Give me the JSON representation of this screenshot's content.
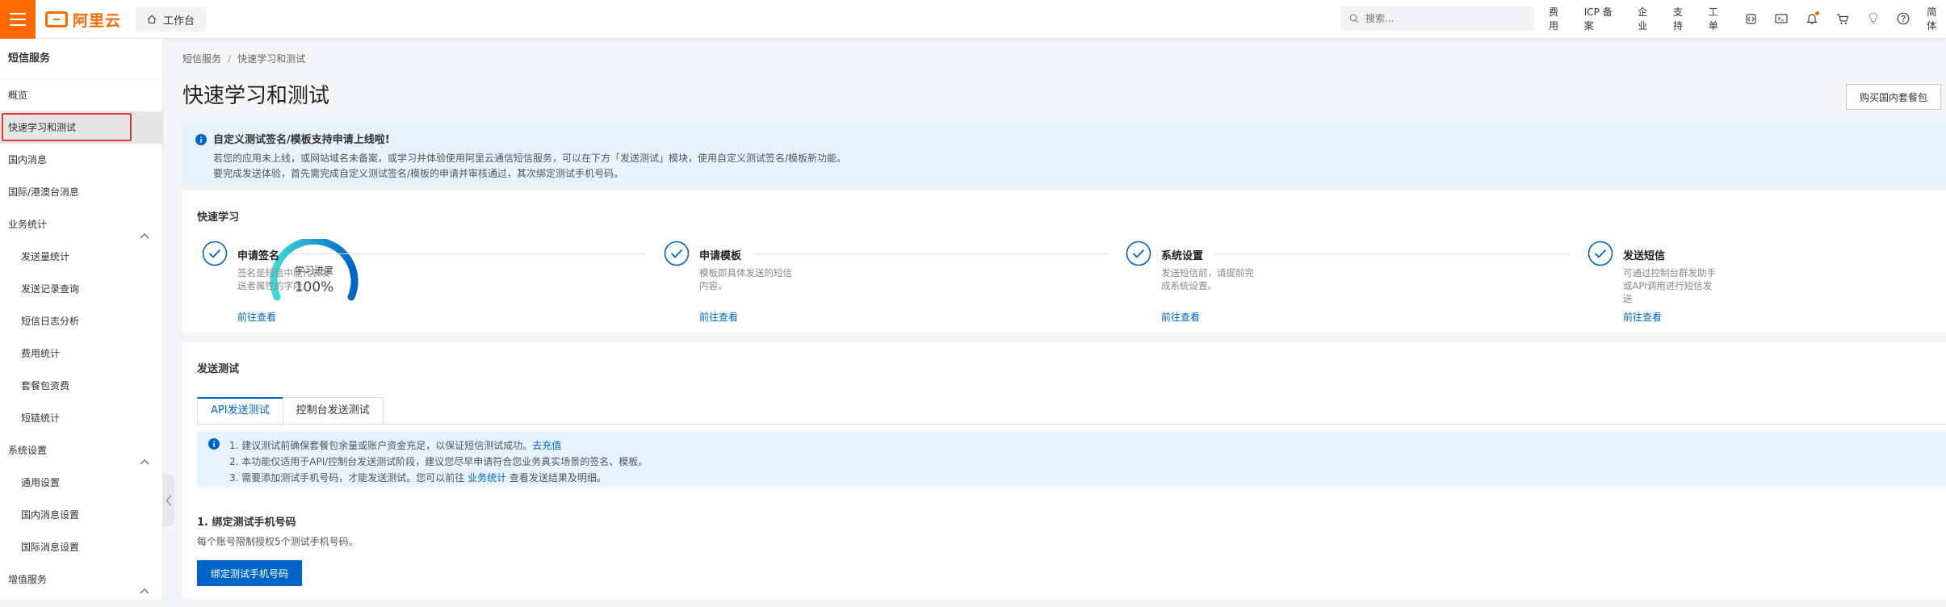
{
  "header": {
    "logo_text": "阿里云",
    "workbench_label": "工作台",
    "search_placeholder": "搜索...",
    "links": [
      "费用",
      "ICP 备案",
      "企业",
      "支持",
      "工单"
    ],
    "user_label": "简体"
  },
  "sidebar": {
    "title": "短信服务",
    "items": [
      {
        "label": "概览",
        "sub": false
      },
      {
        "label": "快速学习和测试",
        "sub": false,
        "active": true
      },
      {
        "label": "国内消息",
        "sub": false
      },
      {
        "label": "国际/港澳台消息",
        "sub": false
      },
      {
        "label": "业务统计",
        "sub": false,
        "group": true
      },
      {
        "label": "发送量统计",
        "sub": true
      },
      {
        "label": "发送记录查询",
        "sub": true
      },
      {
        "label": "短信日志分析",
        "sub": true
      },
      {
        "label": "费用统计",
        "sub": true
      },
      {
        "label": "套餐包资费",
        "sub": true
      },
      {
        "label": "短链统计",
        "sub": true
      },
      {
        "label": "系统设置",
        "sub": false,
        "group": true
      },
      {
        "label": "通用设置",
        "sub": true
      },
      {
        "label": "国内消息设置",
        "sub": true
      },
      {
        "label": "国际消息设置",
        "sub": true
      },
      {
        "label": "增值服务",
        "sub": false,
        "group": true
      }
    ]
  },
  "breadcrumb": {
    "root": "短信服务",
    "sep": "/",
    "current": "快速学习和测试"
  },
  "page_title": "快速学习和测试",
  "buy_button": "购买国内套餐包",
  "notice": {
    "title": "自定义测试签名/模板支持申请上线啦!",
    "line1": "若您的应用未上线，或网站域名未备案，或学习并体验使用阿里云通信短信服务，可以在下方「发送测试」模块，使用自定义测试签名/模板新功能。",
    "line2": "要完成发送体验，首先需完成自定义测试签名/模板的申请并审核通过，其次绑定测试手机号码。"
  },
  "quick_learn": {
    "title": "快速学习",
    "progress_label": "学习进度",
    "progress_value": "100%",
    "progress_fraction": 1.0,
    "steps": [
      {
        "title": "申请签名",
        "desc": "签名是短信中能代表发送者属性的字段。",
        "link": "前往查看"
      },
      {
        "title": "申请模板",
        "desc": "模板即具体发送的短信内容。",
        "link": "前往查看"
      },
      {
        "title": "系统设置",
        "desc": "发送短信前，请提前完成系统设置。",
        "link": "前往查看"
      },
      {
        "title": "发送短信",
        "desc": "可通过控制台群发助手或API调用进行短信发送",
        "link": "前往查看"
      }
    ]
  },
  "send_test": {
    "title": "发送测试",
    "tabs": [
      "API发送测试",
      "控制台发送测试"
    ],
    "tips": [
      {
        "text": "1. 建议测试前确保套餐包余量或账户资金充足，以保证短信测试成功。",
        "link": "去充值",
        "after": ""
      },
      {
        "text": "2. 本功能仅适用于API/控制台发送测试阶段，建议您尽早申请符合您业务真实场景的签名、模板。",
        "link": "",
        "after": ""
      },
      {
        "text": "3. 需要添加测试手机号码，才能发送测试。您可以前往 ",
        "link": "业务统计",
        "after": " 查看发送结果及明细。"
      }
    ],
    "bind_title": "1. 绑定测试手机号码",
    "bind_desc": "每个账号限制授权5个测试手机号码。",
    "bind_button": "绑定测试手机号码"
  },
  "colors": {
    "brand": "#ff6a00",
    "link": "#0064c8",
    "gauge_start": "#3ddbd9",
    "gauge_end": "#0064c8",
    "highlight": "#e4393c"
  }
}
